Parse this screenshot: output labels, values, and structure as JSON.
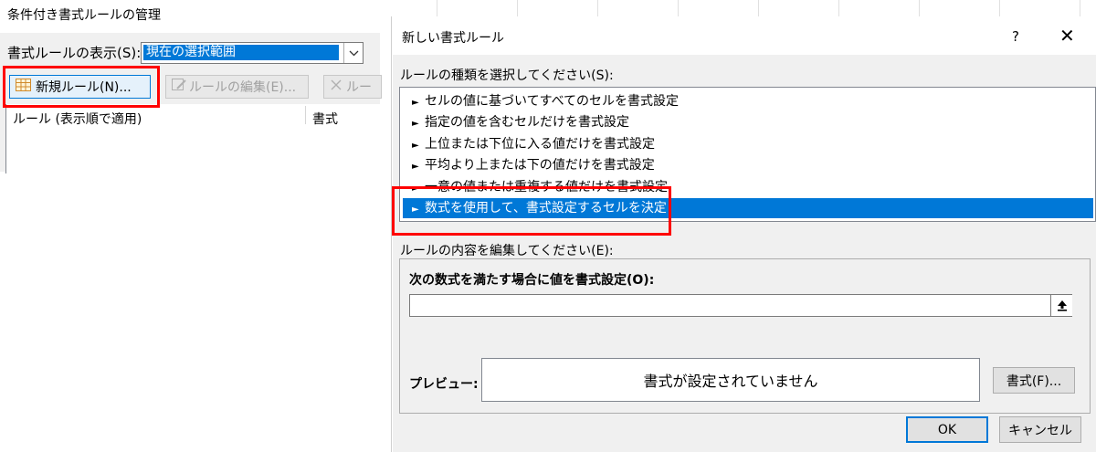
{
  "manager": {
    "title": "条件付き書式ルールの管理",
    "show_rules_label": "書式ルールの表示(S):",
    "show_rules_value": "現在の選択範囲",
    "new_rule_label": "新規ルール(N)...",
    "edit_rule_label": "ルールの編集(E)...",
    "delete_rule_label": "ルー",
    "columns": [
      "ルール (表示順で適用)",
      "書式"
    ]
  },
  "dialog": {
    "title": "新しい書式ルール",
    "help": "?",
    "close": "✕",
    "rule_type_label": "ルールの種類を選択してください(S):",
    "rule_types": [
      "セルの値に基づいてすべてのセルを書式設定",
      "指定の値を含むセルだけを書式設定",
      "上位または下位に入る値だけを書式設定",
      "平均より上または下の値だけを書式設定",
      "一意の値または重複する値だけを書式設定",
      "数式を使用して、書式設定するセルを決定"
    ],
    "selected_rule_type_index": 5,
    "edit_label": "ルールの内容を編集してください(E):",
    "formula_label": "次の数式を満たす場合に値を書式設定(O):",
    "formula_value": "",
    "preview_label": "プレビュー:",
    "preview_text": "書式が設定されていません",
    "format_button": "書式(F)...",
    "ok_button": "OK",
    "cancel_button": "キャンセル"
  },
  "colors": {
    "selection": "#0078d7",
    "highlight_box": "#ff0000",
    "dialog_bg": "#f0f0f0"
  },
  "icons": {
    "new_rule": "table-grid-icon",
    "edit_rule": "edit-icon",
    "delete_rule": "x-icon",
    "bullet": "arrow-bullet-icon",
    "collapse": "collapse-arrow-icon"
  }
}
